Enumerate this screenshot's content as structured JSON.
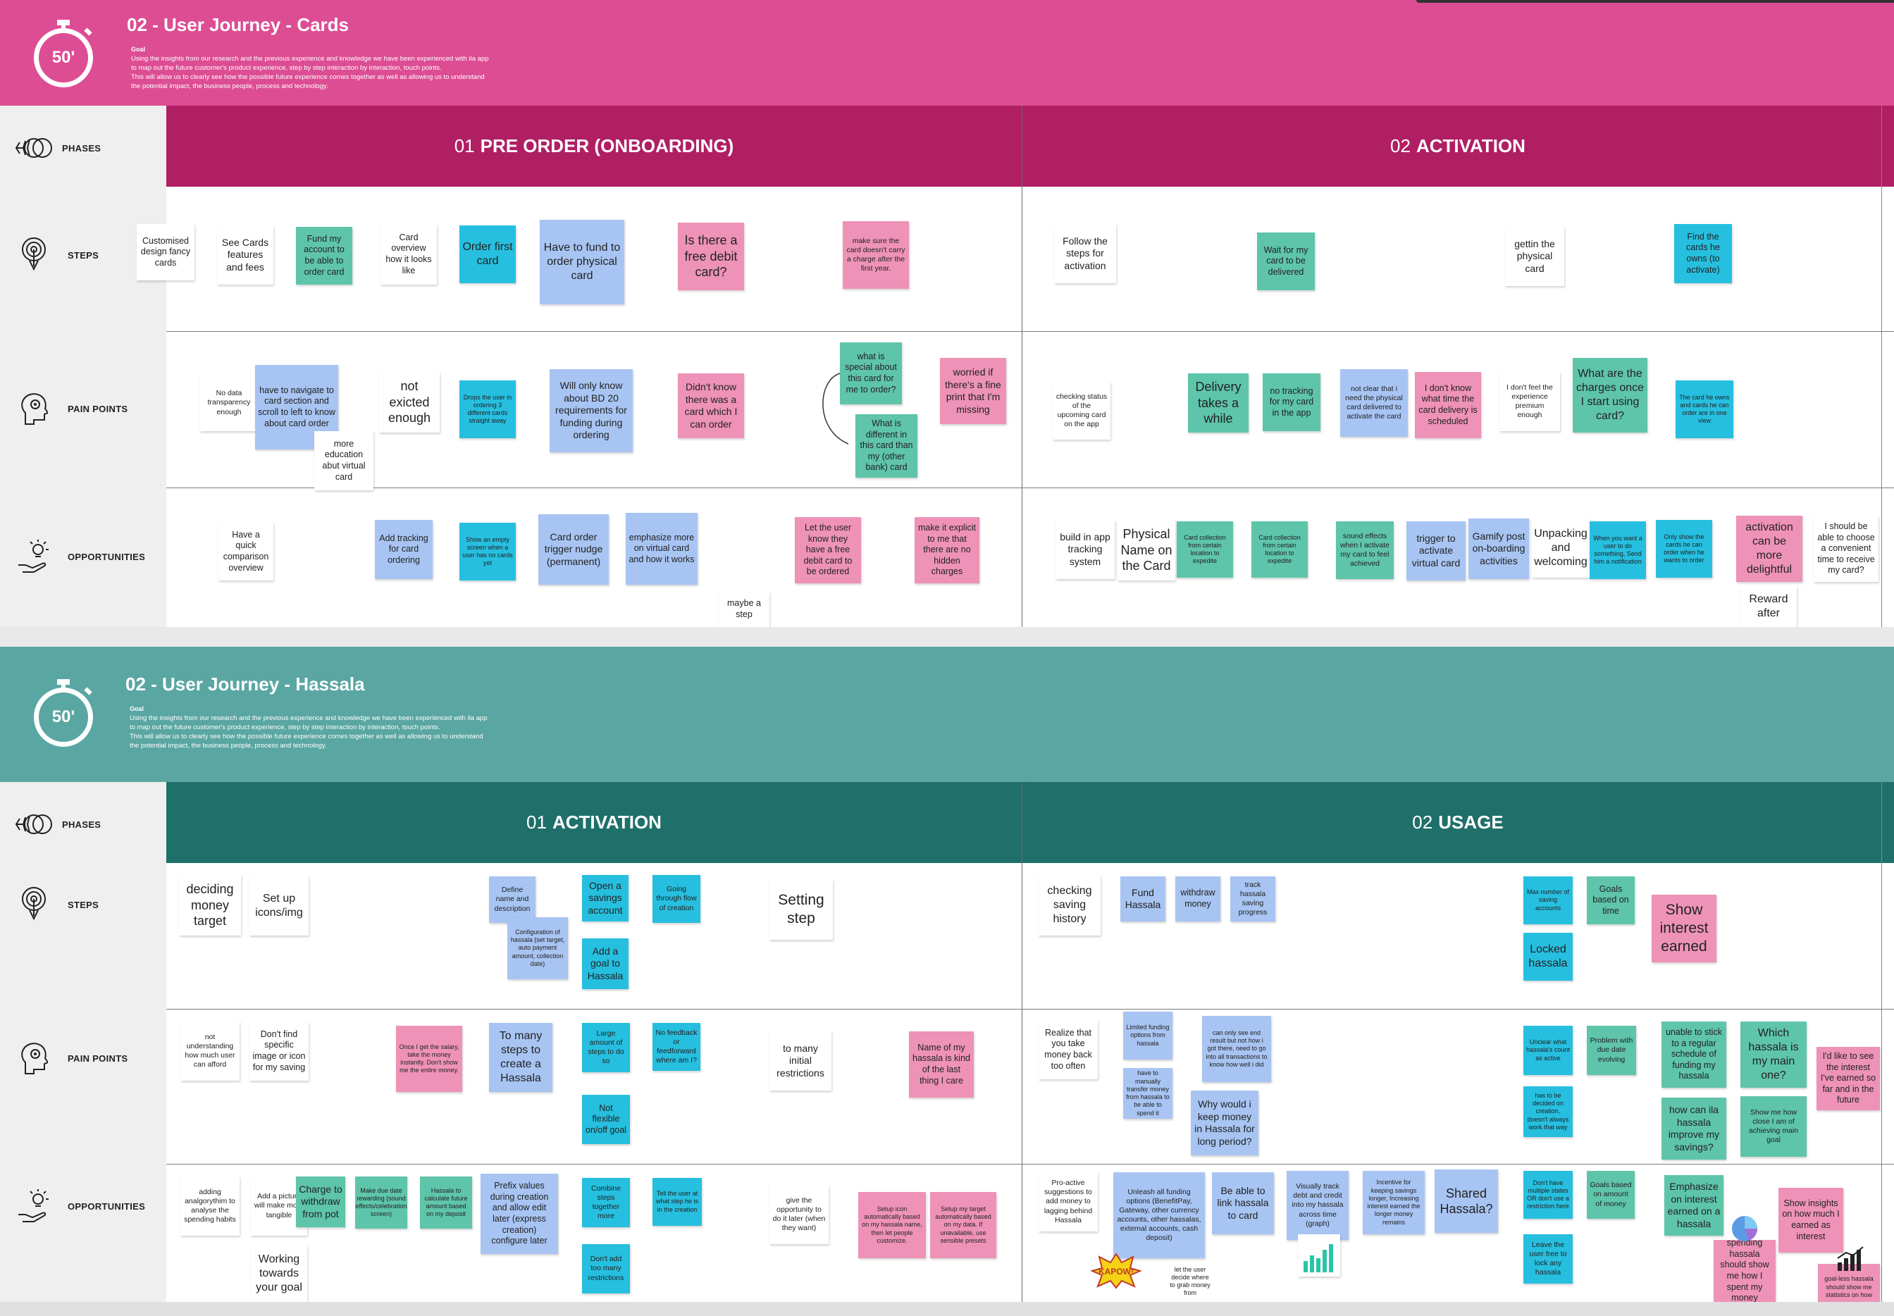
{
  "board1": {
    "title": "02 - User Journey - Cards",
    "timer": "50'",
    "goal_label": "Goal",
    "goal_lines": [
      "Using the insights from our research and the previous experience and knowledge we have been experienced with ila app",
      "to map out the future customer's product experience, step by step interaction by interaction, touch points.",
      "This will allow us to clearly see how the possible future experience comes together as well as allowing us to understand",
      "the potential impact, the business people, process and technology."
    ],
    "phases": [
      {
        "num": "01",
        "name": "PRE ORDER (ONBOARDING)"
      },
      {
        "num": "02",
        "name": "ACTIVATION"
      }
    ]
  },
  "board2": {
    "title": "02 - User Journey - Hassala",
    "timer": "50'",
    "goal_label": "Goal",
    "goal_lines": [
      "Using the insights from our research and the previous experience and knowledge we have been experienced with ila app",
      "to map out the future customer's product experience, step by step interaction by interaction, touch points.",
      " This will allow us to clearly see how the possible future experience comes together as well as allowing us to understand",
      "the potential impact, the business people, process and technology."
    ],
    "phases": [
      {
        "num": "01",
        "name": "ACTIVATION"
      },
      {
        "num": "02",
        "name": "USAGE"
      }
    ]
  },
  "row_labels": {
    "phases": "PHASES",
    "steps": "STEPS",
    "pain": "PAIN POINTS",
    "opps": "OPPORTUNITIES"
  },
  "colors": {
    "pink_header": "#dc4d93",
    "pink_phase": "#b01f63",
    "teal_header": "#5aa6a2",
    "teal_phase": "#1f6f6a"
  },
  "icons": [
    "phases-icon",
    "steps-icon",
    "pain-points-icon",
    "opportunities-icon",
    "stopwatch-icon"
  ],
  "notes1": [
    {
      "t": "Customised design fancy cards"
    },
    {
      "t": "See Cards features and fees"
    },
    {
      "t": "Fund my account to be able to order card"
    },
    {
      "t": "Card overview how it looks like"
    },
    {
      "t": "Order first card"
    },
    {
      "t": "Have to fund to order physical card"
    },
    {
      "t": "Is there a free debit card?"
    },
    {
      "t": "make sure the card doesn't carry a charge after the first year."
    },
    {
      "t": "Follow the steps for activation"
    },
    {
      "t": "Wait for my card to be delivered"
    },
    {
      "t": "gettin the physical card"
    },
    {
      "t": "Find the cards he owns (to activate)"
    },
    {
      "t": "No data transparency enough"
    },
    {
      "t": "have to navigate to card section and scroll to left to know about card order"
    },
    {
      "t": "more education abut virtual card"
    },
    {
      "t": "not exicted enough"
    },
    {
      "t": "Drops the user in ordering 3 different cards straight away"
    },
    {
      "t": "Will only know about BD 20 requirements for funding during ordering"
    },
    {
      "t": "Didn't know there was a card which I can order"
    },
    {
      "t": "what is special about this card for me to order?"
    },
    {
      "t": "What is different in this card than my (other bank) card"
    },
    {
      "t": "worried if there's a fine print that I'm missing"
    },
    {
      "t": "checking status of the upcoming card on the app"
    },
    {
      "t": "Delivery takes a while"
    },
    {
      "t": "no tracking for my card in the app"
    },
    {
      "t": "not clear that i need the physical card delivered to activate the card"
    },
    {
      "t": "I don't know what time the card delivery is scheduled"
    },
    {
      "t": "I don't feel the experience premium enough"
    },
    {
      "t": "What are the charges once I start using card?"
    },
    {
      "t": "The card he owns and cards he can order are in one view"
    },
    {
      "t": "Have a quick comparison overview"
    },
    {
      "t": "Add tracking for card ordering"
    },
    {
      "t": "Show an empty screen when a user has no cards yet"
    },
    {
      "t": "Card order trigger nudge (permanent)"
    },
    {
      "t": "emphasize more on virtual card and how it works"
    },
    {
      "t": "maybe a step"
    },
    {
      "t": "Let the user know they have a free debit card to be ordered"
    },
    {
      "t": "make it explicit to me that there are no hidden charges"
    },
    {
      "t": "build in app tracking system"
    },
    {
      "t": "Physical Name on the Card"
    },
    {
      "t": "Card collection from certain location to expedite"
    },
    {
      "t": "Card collection from certain location to expedite"
    },
    {
      "t": "sound effects when I activate my card to feel achieved"
    },
    {
      "t": "trigger to activate virtual card"
    },
    {
      "t": "Gamify post on-boarding activities"
    },
    {
      "t": "Unpacking and welcoming"
    },
    {
      "t": "When you want a user to do something, Send him a notification"
    },
    {
      "t": "Only show the cards he can order when he wants to order"
    },
    {
      "t": "activation can be more delightful"
    },
    {
      "t": "Reward after"
    },
    {
      "t": "I should be able to choose a convenient time to receive my card?"
    }
  ],
  "notes2": [
    {
      "t": "deciding money target"
    },
    {
      "t": "Set up icons/img"
    },
    {
      "t": "Define name and description"
    },
    {
      "t": "Configuration of hassala (set target, auto payment amount, collection date)"
    },
    {
      "t": "Open a savings account"
    },
    {
      "t": "Add a goal to Hassala"
    },
    {
      "t": "Going through flow of creation"
    },
    {
      "t": "Setting step"
    },
    {
      "t": "checking saving history"
    },
    {
      "t": "Fund Hassala"
    },
    {
      "t": "withdraw money"
    },
    {
      "t": "track hassala saving progress"
    },
    {
      "t": "Max number of saving accounts"
    },
    {
      "t": "Goals based on time"
    },
    {
      "t": "Locked hassala"
    },
    {
      "t": "Show interest earned"
    },
    {
      "t": "not understanding how much user can afford"
    },
    {
      "t": "Don't find specific image or icon for my saving"
    },
    {
      "t": "Once I get the salary, take the money instantly. Don't show me the entire money."
    },
    {
      "t": "To many steps to create a Hassala"
    },
    {
      "t": "Large amount of steps to do so"
    },
    {
      "t": "Not flexible on/off goal"
    },
    {
      "t": "No feedback or feedforward where am I?"
    },
    {
      "t": "to many initial restrictions"
    },
    {
      "t": "Name of my hassala is kind of the last thing I care"
    },
    {
      "t": "Realize that you take money back too often"
    },
    {
      "t": "Limited funding options from hassala"
    },
    {
      "t": "have to manually transfer money from hassala to be able to spend it"
    },
    {
      "t": "can only see end result but not how i got there, need to go into all transactions to know how well i did"
    },
    {
      "t": "Why would i keep money in Hassala for long period?"
    },
    {
      "t": "Unclear what hassala's count as active"
    },
    {
      "t": "has to be decided on creation, doesn't always work that way"
    },
    {
      "t": "Problem with due date evolving"
    },
    {
      "t": "unable to stick to a regular schedule of funding my hassala"
    },
    {
      "t": "how can ila hassala improve my savings?"
    },
    {
      "t": "Which hassala is my main one?"
    },
    {
      "t": "Show me how close I am of achieving main goal"
    },
    {
      "t": "I'd like to see the interest I've earned so far and in the future"
    },
    {
      "t": "adding analgorythim to analyse the spending habits"
    },
    {
      "t": "Add a picture will make more tangible"
    },
    {
      "t": "Charge to withdraw from pot"
    },
    {
      "t": "Make due date rewarding (sound effects/celebration screen)"
    },
    {
      "t": "Hassala to calculate future amount based on my deposit"
    },
    {
      "t": "Prefix values during creation and allow edit later (express creation) configure later"
    },
    {
      "t": "Working towards your goal"
    },
    {
      "t": "Combine steps together more"
    },
    {
      "t": "Don't add too many restrictions"
    },
    {
      "t": "Tell the user at what step he is in the creation"
    },
    {
      "t": "give the opportunity to do it later (when they want)"
    },
    {
      "t": "Setup icon automatically based on my hassala name, then let people customize."
    },
    {
      "t": "Setup my target automatically based on my data. If unavailable, use sensible presets"
    },
    {
      "t": "Pro-active suggestions to add money to lagging behind Hassala"
    },
    {
      "t": "Unleash all funding options (BenefitPay, Gateway, other currency accounts, other hassalas, external accounts, cash deposit)"
    },
    {
      "t": "let the user decide where to grab money from"
    },
    {
      "t": "Be able to link hassala to card"
    },
    {
      "t": "Visually track debt and credit into my hassala across time (graph)"
    },
    {
      "t": "Incentive for keeping savings longer, Increasing interest earned the longer money remains"
    },
    {
      "t": "Shared Hassala?"
    },
    {
      "t": "Don't have multiple states OR don't use a restriction here"
    },
    {
      "t": "Leave the user free to lock any hassala"
    },
    {
      "t": "Goals based on amount of money"
    },
    {
      "t": "Emphasize on interest earned on a hassala"
    },
    {
      "t": "spending hassala should show me how I spent my money"
    },
    {
      "t": "Show insights on how much I earned as interest"
    },
    {
      "t": "goal-less hassala should show me statistics on how"
    },
    {
      "t": "KAPOW!"
    }
  ]
}
